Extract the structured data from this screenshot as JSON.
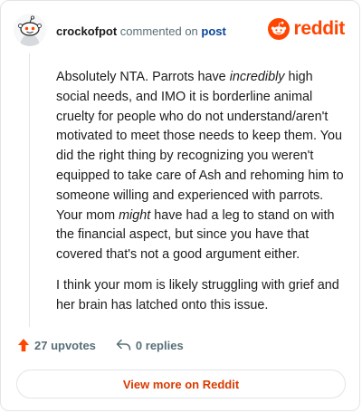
{
  "header": {
    "username": "crockofpot",
    "action_text": " commented on ",
    "post_link": "post",
    "brand": "reddit"
  },
  "comment": {
    "p1_a": "Absolutely NTA. Parrots have ",
    "p1_em1": "incredibly",
    "p1_b": " high social needs, and IMO it is borderline animal cruelty for people who do not understand/aren't motivated to meet those needs to keep them. You did the right thing by recognizing you weren't equipped to take care of Ash and rehoming him to someone willing and experienced with parrots. Your mom ",
    "p1_em2": "might",
    "p1_c": " have had a leg to stand on with the financial aspect, but since you have that covered that's not a good argument either.",
    "p2": "I think your mom is likely struggling with grief and her brain has latched onto this issue."
  },
  "actions": {
    "upvotes": "27 upvotes",
    "replies": "0 replies"
  },
  "view_button": "View more on Reddit",
  "colors": {
    "brand": "#ff4500",
    "link": "#0a449b",
    "button_text": "#d93a00",
    "muted": "#576f76"
  },
  "icons": [
    "avatar-snoo-icon",
    "reddit-logo-icon",
    "upvote-arrow-icon",
    "reply-arrow-icon"
  ]
}
